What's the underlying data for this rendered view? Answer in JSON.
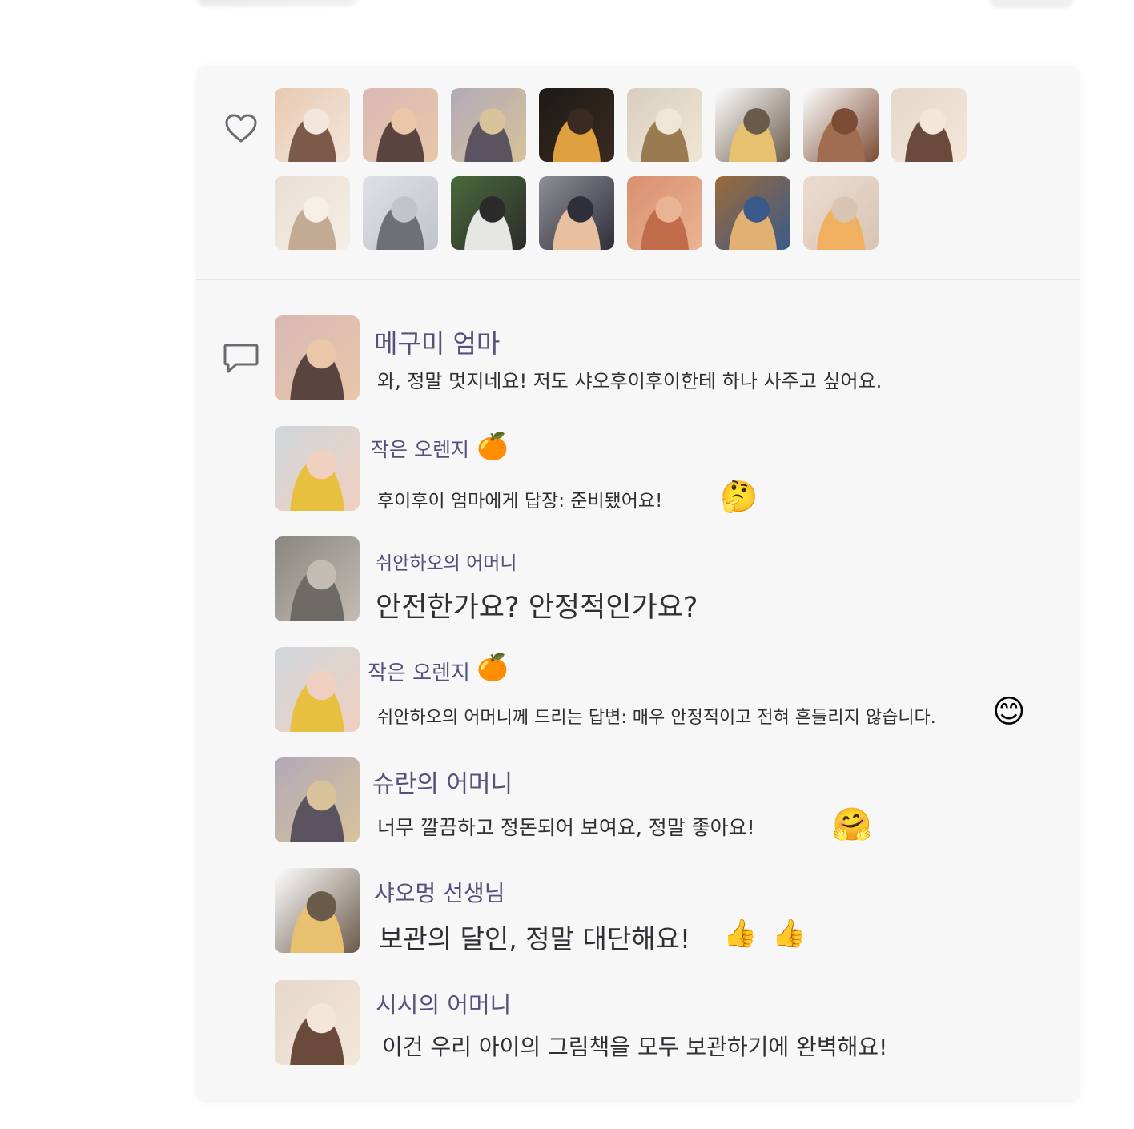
{
  "likes": {
    "icon": "heart-icon",
    "avatars": [
      {
        "name": "avatar-girl-sunglasses",
        "colors": [
          "#e8c9b0",
          "#7b5a4a",
          "#f3e6dc"
        ]
      },
      {
        "name": "avatar-girl-snacks",
        "colors": [
          "#d9b8b6",
          "#5a4440",
          "#e9c7a8"
        ]
      },
      {
        "name": "avatar-owl-toy",
        "colors": [
          "#b2a9b8",
          "#5c5360",
          "#d8c39a"
        ]
      },
      {
        "name": "avatar-star-cushion",
        "colors": [
          "#1e1a18",
          "#e0a040",
          "#3a2a20"
        ]
      },
      {
        "name": "avatar-cats",
        "colors": [
          "#d8cfc0",
          "#9a7a50",
          "#efe6d6"
        ]
      },
      {
        "name": "avatar-banana-cats",
        "colors": [
          "#ffffff",
          "#e7c070",
          "#6a5a4a"
        ]
      },
      {
        "name": "avatar-bear",
        "colors": [
          "#ffffff",
          "#a06d50",
          "#7b4c34"
        ]
      },
      {
        "name": "avatar-baby-hands",
        "colors": [
          "#e5d7ca",
          "#6a4a3a",
          "#f5e6da"
        ]
      },
      {
        "name": "avatar-child-room",
        "colors": [
          "#e8ded4",
          "#c3aa92",
          "#f5efe8"
        ]
      },
      {
        "name": "avatar-blanket-child",
        "colors": [
          "#dfe0e4",
          "#6e7078",
          "#c2c4cc"
        ]
      },
      {
        "name": "avatar-panda",
        "colors": [
          "#4a6a3a",
          "#e6e6e2",
          "#2b2b2b"
        ]
      },
      {
        "name": "avatar-saluting-boy",
        "colors": [
          "#8e8e96",
          "#e8c0a0",
          "#2f2f3a"
        ]
      },
      {
        "name": "avatar-orange-cat",
        "colors": [
          "#d89070",
          "#c06c4a",
          "#eab494"
        ]
      },
      {
        "name": "avatar-cat-costume",
        "colors": [
          "#9c6a3a",
          "#e2b070",
          "#3a5a8a"
        ]
      },
      {
        "name": "avatar-baby-food",
        "colors": [
          "#ecdcd0",
          "#f0b060",
          "#d9c4b4"
        ]
      }
    ]
  },
  "comments": [
    {
      "name": "메구미 엄마",
      "text": "와, 정말 멋지네요! 저도 샤오후이후이한테 하나 사주고 싶어요.",
      "avatar": {
        "name": "avatar-girl-snacks",
        "colors": [
          "#d9b8b6",
          "#5a4440",
          "#e9c7a8"
        ]
      }
    },
    {
      "name": "작은 오렌지",
      "name_emoji": "🍊",
      "text": "후이후이 엄마에게 답장: 준비됐어요!",
      "text_emoji": "🤔",
      "avatar": {
        "name": "avatar-girl-yellow-scarf",
        "colors": [
          "#cfd6dc",
          "#e8c040",
          "#f0d0c0"
        ]
      }
    },
    {
      "name": "쉬안하오의 어머니",
      "text": "안전한가요? 안정적인가요?",
      "avatar": {
        "name": "avatar-child-playing",
        "colors": [
          "#8a8680",
          "#6e6a66",
          "#c2bcb4"
        ]
      }
    },
    {
      "name": "작은 오렌지",
      "name_emoji": "🍊",
      "text": "쉬안하오의 어머니께 드리는 답변: 매우 안정적이고 전혀 흔들리지 않습니다.",
      "text_emoji": "😊",
      "avatar": {
        "name": "avatar-girl-yellow-scarf",
        "colors": [
          "#cfd6dc",
          "#e8c040",
          "#f0d0c0"
        ]
      }
    },
    {
      "name": "슈란의 어머니",
      "text": "너무 깔끔하고 정돈되어 보여요, 정말 좋아요!",
      "text_emoji": "🤗",
      "avatar": {
        "name": "avatar-owl-toy",
        "colors": [
          "#b2a9b8",
          "#5c5360",
          "#d8c39a"
        ]
      }
    },
    {
      "name": "샤오멍 선생님",
      "text": "보관의 달인, 정말 대단해요!",
      "text_emoji": "👍 👍",
      "avatar": {
        "name": "avatar-banana-cats",
        "colors": [
          "#ffffff",
          "#e7c070",
          "#6a5a4a"
        ]
      }
    },
    {
      "name": "시시의 어머니",
      "text": "이건 우리 아이의 그림책을 모두 보관하기에 완벽해요!",
      "avatar": {
        "name": "avatar-baby-hands",
        "colors": [
          "#e5d7ca",
          "#6a4a3a",
          "#f5e6da"
        ]
      }
    }
  ],
  "colors": {
    "card_bg": "#f7f7f8",
    "name": "#56507a",
    "text": "#2f2f34",
    "icon": "#6b6b72"
  }
}
